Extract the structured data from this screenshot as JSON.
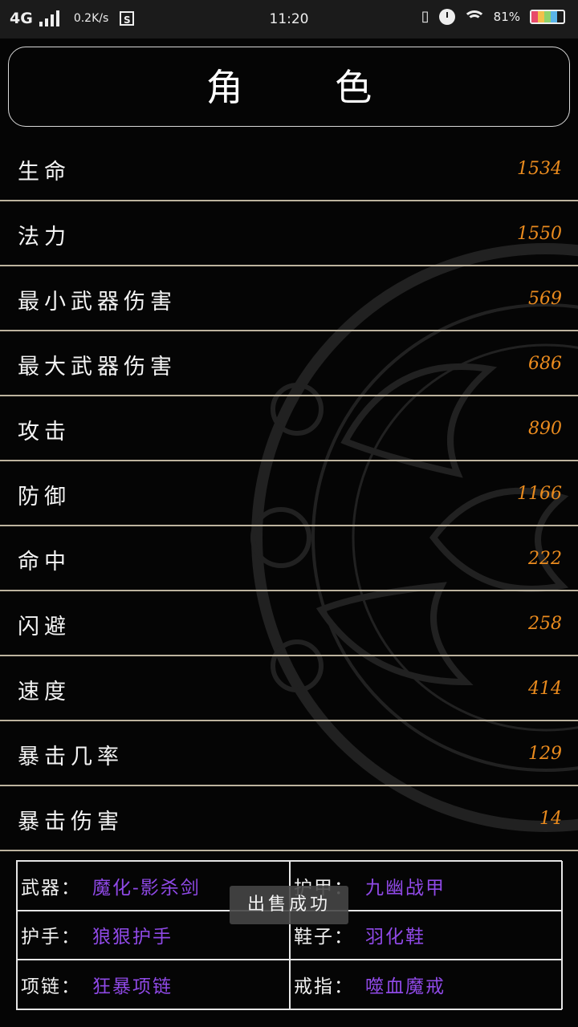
{
  "status_bar": {
    "network": "4G",
    "speed": "0.2K/s",
    "time": "11:20",
    "battery": "81%"
  },
  "title": "角 色",
  "stats": [
    {
      "label": "生命",
      "value": "1534"
    },
    {
      "label": "法力",
      "value": "1550"
    },
    {
      "label": "最小武器伤害",
      "value": "569"
    },
    {
      "label": "最大武器伤害",
      "value": "686"
    },
    {
      "label": "攻击",
      "value": "890"
    },
    {
      "label": "防御",
      "value": "1166"
    },
    {
      "label": "命中",
      "value": "222"
    },
    {
      "label": "闪避",
      "value": "258"
    },
    {
      "label": "速度",
      "value": "414"
    },
    {
      "label": "暴击几率",
      "value": "129"
    },
    {
      "label": "暴击伤害",
      "value": "14"
    }
  ],
  "equipment": [
    {
      "slot": "武器：",
      "item": "魔化-影杀剑"
    },
    {
      "slot": "护甲：",
      "item": "九幽战甲"
    },
    {
      "slot": "护手：",
      "item": "狼狠护手"
    },
    {
      "slot": "鞋子：",
      "item": "羽化鞋"
    },
    {
      "slot": "项链：",
      "item": "狂暴项链"
    },
    {
      "slot": "戒指：",
      "item": "噬血魔戒"
    }
  ],
  "toast": "出售成功",
  "colors": {
    "value_orange": "#ea8b1e",
    "item_purple": "#8f49e6",
    "divider": "#bdb39e"
  }
}
